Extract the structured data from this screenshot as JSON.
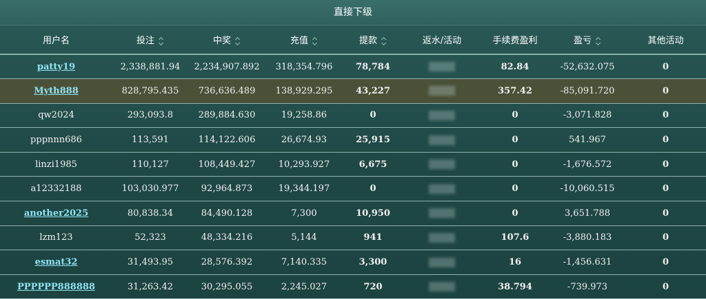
{
  "title": "直接下级",
  "columns": [
    {
      "label": "用户名",
      "sortable": false
    },
    {
      "label": "投注",
      "sortable": true
    },
    {
      "label": "中奖",
      "sortable": true
    },
    {
      "label": "充值",
      "sortable": true
    },
    {
      "label": "提款",
      "sortable": true
    },
    {
      "label": "返水/活动",
      "sortable": false
    },
    {
      "label": "手续费盈利",
      "sortable": false
    },
    {
      "label": "盈亏",
      "sortable": true
    },
    {
      "label": "其他活动",
      "sortable": false
    }
  ],
  "rows": [
    {
      "user": "patty19",
      "link": true,
      "bet": "2,338,881.94",
      "win": "2,234,907.892",
      "deposit": "318,354.796",
      "withdraw": "78,784",
      "fee": "82.84",
      "pnl": "-52,632.075",
      "other": "0",
      "highlight": false
    },
    {
      "user": "Myth888",
      "link": true,
      "bet": "828,795.435",
      "win": "736,636.489",
      "deposit": "138,929.295",
      "withdraw": "43,227",
      "fee": "357.42",
      "pnl": "-85,091.720",
      "other": "0",
      "highlight": true
    },
    {
      "user": "qw2024",
      "link": false,
      "bet": "293,093.8",
      "win": "289,884.630",
      "deposit": "19,258.86",
      "withdraw": "0",
      "fee": "0",
      "pnl": "-3,071.828",
      "other": "0",
      "highlight": false
    },
    {
      "user": "pppnnn686",
      "link": false,
      "bet": "113,591",
      "win": "114,122.606",
      "deposit": "26,674.93",
      "withdraw": "25,915",
      "fee": "0",
      "pnl": "541.967",
      "other": "0",
      "highlight": false
    },
    {
      "user": "linzi1985",
      "link": false,
      "bet": "110,127",
      "win": "108,449.427",
      "deposit": "10,293.927",
      "withdraw": "6,675",
      "fee": "0",
      "pnl": "-1,676.572",
      "other": "0",
      "highlight": false
    },
    {
      "user": "a12332188",
      "link": false,
      "bet": "103,030.977",
      "win": "92,964.873",
      "deposit": "19,344.197",
      "withdraw": "0",
      "fee": "0",
      "pnl": "-10,060.515",
      "other": "0",
      "highlight": false
    },
    {
      "user": "another2025",
      "link": true,
      "bet": "80,838.34",
      "win": "84,490.128",
      "deposit": "7,300",
      "withdraw": "10,950",
      "fee": "0",
      "pnl": "3,651.788",
      "other": "0",
      "highlight": false
    },
    {
      "user": "lzm123",
      "link": false,
      "bet": "52,323",
      "win": "48,334.216",
      "deposit": "5,144",
      "withdraw": "941",
      "fee": "107.6",
      "pnl": "-3,880.183",
      "other": "0",
      "highlight": false
    },
    {
      "user": "esmat32",
      "link": true,
      "bet": "31,493.95",
      "win": "28,576.392",
      "deposit": "7,140.335",
      "withdraw": "3,300",
      "fee": "16",
      "pnl": "-1,456.631",
      "other": "0",
      "highlight": false
    },
    {
      "user": "PPPPPP888888",
      "link": true,
      "bet": "31,263.42",
      "win": "30,295.055",
      "deposit": "2,245.027",
      "withdraw": "720",
      "fee": "38.794",
      "pnl": "-739.973",
      "other": "0",
      "highlight": false
    }
  ]
}
